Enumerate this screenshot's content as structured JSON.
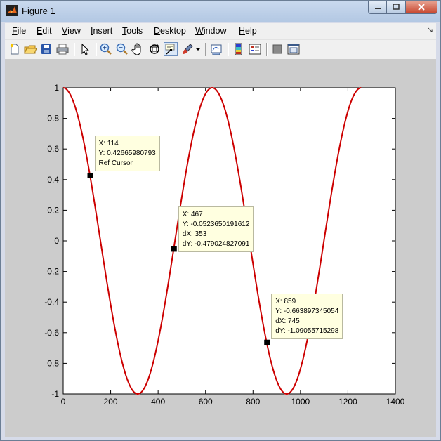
{
  "window": {
    "title": "Figure 1"
  },
  "menu": [
    "File",
    "Edit",
    "View",
    "Insert",
    "Tools",
    "Desktop",
    "Window",
    "Help"
  ],
  "toolbar": [
    {
      "name": "new-figure-icon"
    },
    {
      "name": "open-file-icon"
    },
    {
      "name": "save-icon"
    },
    {
      "name": "print-icon"
    },
    {
      "name": "edit-plot-arrow-icon"
    },
    {
      "name": "zoom-in-icon"
    },
    {
      "name": "zoom-out-icon"
    },
    {
      "name": "pan-hand-icon"
    },
    {
      "name": "rotate-3d-icon"
    },
    {
      "name": "data-cursor-icon",
      "active": true
    },
    {
      "name": "brush-icon"
    },
    {
      "name": "link-plot-icon"
    },
    {
      "name": "insert-colorbar-icon"
    },
    {
      "name": "insert-legend-icon"
    },
    {
      "name": "hide-plot-tools-icon"
    },
    {
      "name": "show-plot-tools-icon"
    }
  ],
  "colors": {
    "line": "#cc0000",
    "axes_bg": "#ffffff",
    "figure_bg": "#cccccc",
    "tip_bg": "#ffffe0"
  },
  "chart_data": {
    "type": "line",
    "title": "",
    "xlabel": "",
    "ylabel": "",
    "xlim": [
      0,
      1400
    ],
    "ylim": [
      -1,
      1
    ],
    "xticks": [
      0,
      200,
      400,
      600,
      800,
      1000,
      1200,
      1400
    ],
    "yticks": [
      1,
      0.8,
      0.6,
      0.4,
      0.2,
      0,
      -0.2,
      -0.4,
      -0.6,
      -0.8,
      -1
    ],
    "xtick_labels": [
      "0",
      "200",
      "400",
      "600",
      "800",
      "1000",
      "1200",
      "1400"
    ],
    "ytick_labels": [
      "1",
      "0.8",
      "0.6",
      "0.4",
      "0.2",
      "0",
      "-0.2",
      "-0.4",
      "-0.6",
      "-0.8",
      "-1"
    ],
    "series": [
      {
        "function": "cos(2*pi*x/628)",
        "x_range": [
          0,
          1256
        ],
        "color": "#cc0000"
      }
    ],
    "grid": false,
    "data_tips": [
      {
        "x": 114,
        "y": 0.42665980793,
        "lines": [
          "X: 114",
          "Y: 0.42665980793",
          "Ref Cursor"
        ]
      },
      {
        "x": 467,
        "y": -0.0523650191612,
        "lines": [
          "X: 467",
          "Y: -0.0523650191612",
          "dX: 353",
          "dY: -0.479024827091"
        ]
      },
      {
        "x": 859,
        "y": -0.663897345054,
        "lines": [
          "X: 859",
          "Y: -0.663897345054",
          "dX: 745",
          "dY: -1.09055715298"
        ]
      }
    ]
  }
}
